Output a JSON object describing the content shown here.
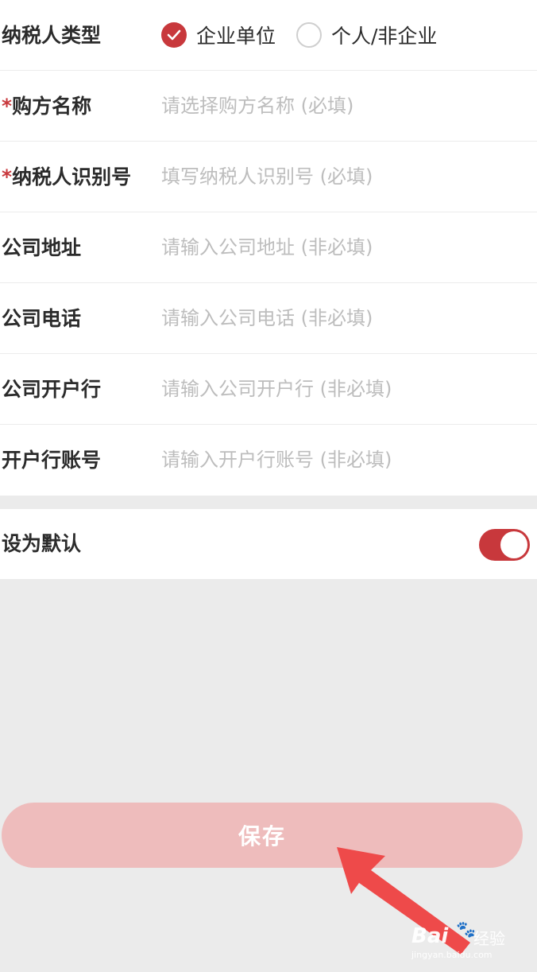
{
  "form": {
    "taxpayer_type": {
      "label": "纳税人类型",
      "options": [
        {
          "label": "企业单位",
          "selected": true
        },
        {
          "label": "个人/非企业",
          "selected": false
        }
      ]
    },
    "fields": [
      {
        "required": true,
        "label": "购方名称",
        "placeholder": "请选择购方名称 (必填)"
      },
      {
        "required": true,
        "label": "纳税人识别号",
        "placeholder": "填写纳税人识别号 (必填)"
      },
      {
        "required": false,
        "label": "公司地址",
        "placeholder": "请输入公司地址 (非必填)"
      },
      {
        "required": false,
        "label": "公司电话",
        "placeholder": "请输入公司电话 (非必填)"
      },
      {
        "required": false,
        "label": "公司开户行",
        "placeholder": "请输入公司开户行 (非必填)"
      },
      {
        "required": false,
        "label": "开户行账号",
        "placeholder": "请输入开户行账号 (非必填)"
      }
    ],
    "required_mark": "*"
  },
  "default_setting": {
    "label": "设为默认",
    "enabled": true
  },
  "save_button": {
    "label": "保存"
  },
  "watermark": {
    "logo": "Bai",
    "suffix": "经验",
    "url": "jingyan.baidu.com"
  },
  "colors": {
    "accent": "#c8383c",
    "save_button_bg": "#eebcbc",
    "arrow": "#ee4a4a",
    "page_bg": "#ebebeb"
  }
}
